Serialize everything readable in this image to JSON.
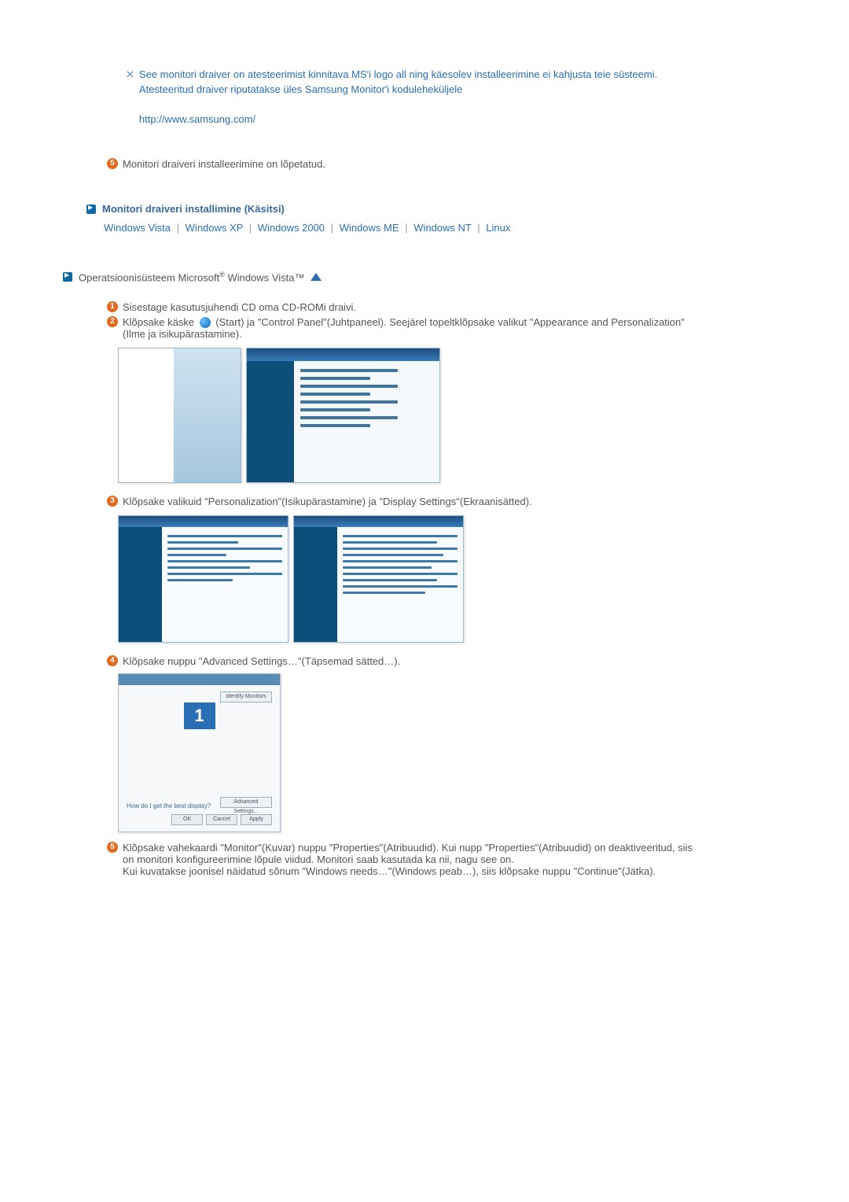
{
  "intro": {
    "line1": "See monitori draiver on atesteerimist kinnitava MS'i logo all ning käesolev installeerimine ei kahjusta teie süsteemi.",
    "line2": "Atesteeritud draiver riputatakse üles Samsung Monitor'i koduleheküljele",
    "url": "http://www.samsung.com/"
  },
  "step5_text": "Monitori draiveri installeerimine on lõpetatud.",
  "manual_heading": "Monitori draiveri installimine (Käsitsi)",
  "os_links": {
    "vista": "Windows Vista",
    "xp": "Windows XP",
    "w2000": "Windows 2000",
    "me": "Windows ME",
    "nt": "Windows NT",
    "linux": "Linux"
  },
  "os_label_prefix": "Operatsioonisüsteem Microsoft",
  "os_label_suffix": " Windows Vista™",
  "steps": {
    "s1": "Sisestage kasutusjuhendi CD oma CD-ROMi draivi.",
    "s2a": "Klõpsake käske ",
    "s2b": "(Start) ja \"Control Panel\"(Juhtpaneel). Seejärel topeltklõpsake valikut \"Appearance and Personalization\"(Ilme ja isikupärastamine).",
    "s3": "Klõpsake valikuid \"Personalization\"(Isikupärastamine) ja \"Display Settings\"(Ekraanisätted).",
    "s4": "Klõpsake nuppu \"Advanced Settings…\"(Täpsemad sätted…).",
    "s5": "Klõpsake vahekaardi \"Monitor\"(Kuvar) nuppu \"Properties\"(Atribuudid). Kui nupp \"Properties\"(Atribuudid) on deaktiveeritud, siis on monitori konfigureerimine lõpule viidud. Monitori saab kasutada ka nii, nagu see on.",
    "s5b": "Kui kuvatakse joonisel näidatud sõnum \"Windows needs…\"(Windows peab…), siis klõpsake nuppu \"Continue\"(Jätka)."
  },
  "disp": {
    "identify": "Identify Monitors",
    "advanced": "Advanced Settings...",
    "ok": "OK",
    "cancel": "Cancel",
    "apply": "Apply",
    "helptxt": "How do I get the best display?",
    "mon": "1"
  }
}
